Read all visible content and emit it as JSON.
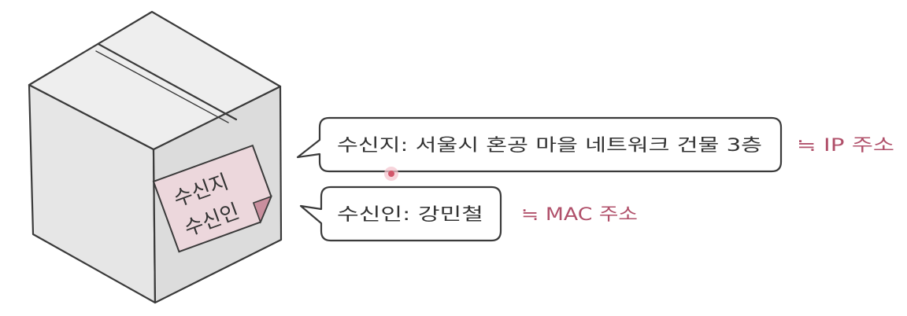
{
  "box": {
    "label_line1": "수신지",
    "label_line2": "수신인"
  },
  "destination": {
    "text": "수신지: 서울시 혼공 마을 네트워크 건물 3층",
    "note": "≒ IP 주소"
  },
  "recipient": {
    "text": "수신인: 강민철",
    "note": "≒ MAC 주소"
  },
  "colors": {
    "box_face": "#e6e6e6",
    "box_side": "#dedede",
    "label_fill": "#ecd7dc",
    "note_text": "#b0506a",
    "cursor_dot": "#d2566a"
  }
}
